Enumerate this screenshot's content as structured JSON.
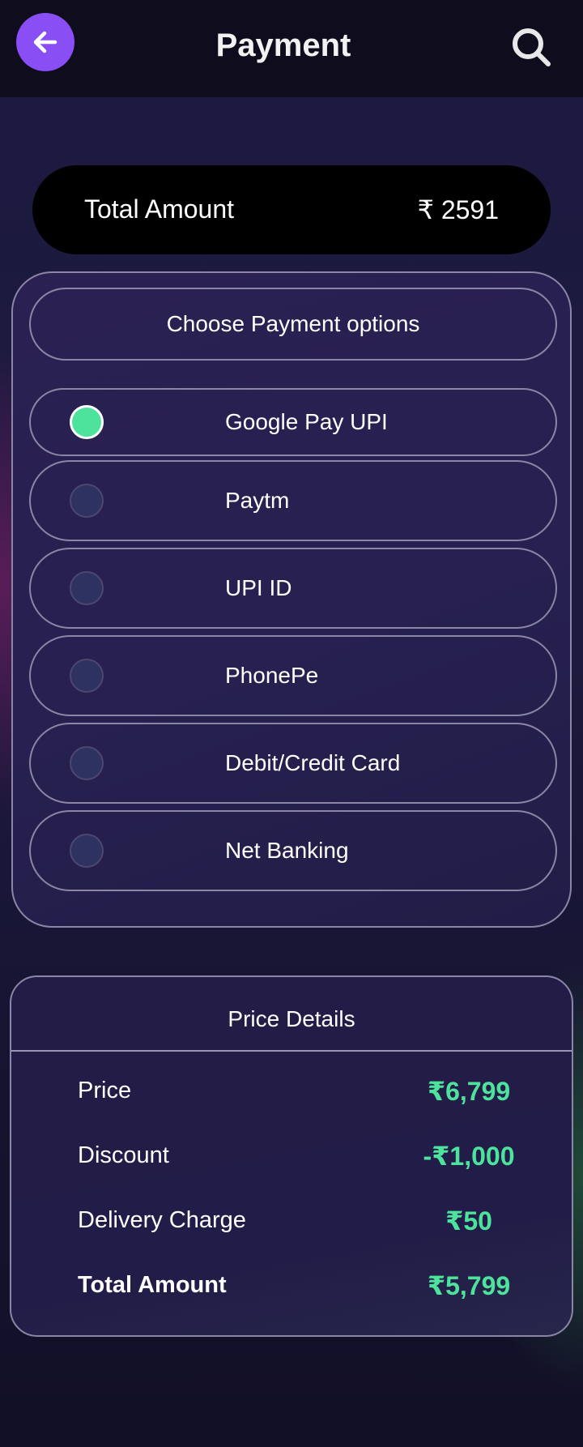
{
  "header": {
    "title": "Payment",
    "back_icon": "arrow-left-icon",
    "search_icon": "search-icon",
    "accent_color": "#8a4ef5"
  },
  "summary": {
    "label": "Total Amount",
    "amount": "₹ 2591"
  },
  "payment_options": {
    "heading": "Choose Payment options",
    "selected": "Google Pay UPI",
    "items": [
      {
        "label": "Google Pay UPI",
        "selected": true
      },
      {
        "label": "Paytm",
        "selected": false
      },
      {
        "label": "UPI ID",
        "selected": false
      },
      {
        "label": "PhonePe",
        "selected": false
      },
      {
        "label": "Debit/Credit Card",
        "selected": false
      },
      {
        "label": "Net Banking",
        "selected": false
      }
    ]
  },
  "price_details": {
    "heading": "Price Details",
    "rows": [
      {
        "label": "Price",
        "value": "₹6,799"
      },
      {
        "label": "Discount",
        "value": "-₹1,000"
      },
      {
        "label": "Delivery Charge",
        "value": "₹50"
      },
      {
        "label": "Total Amount",
        "value": "₹5,799"
      }
    ]
  },
  "colors": {
    "value_green": "#4ee39c",
    "background": "#1c1a3e"
  }
}
